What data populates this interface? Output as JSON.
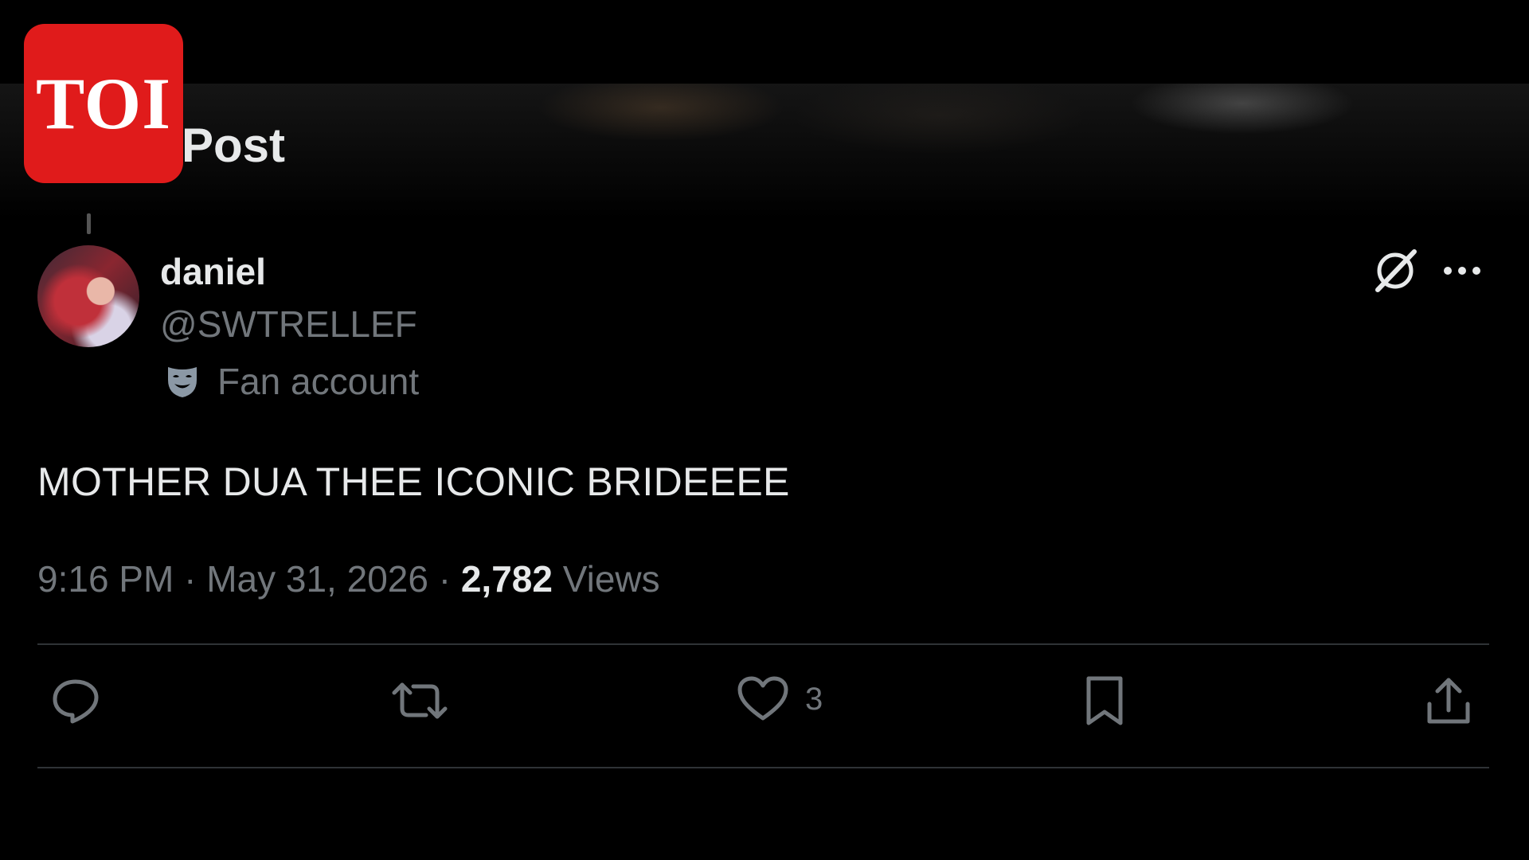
{
  "logo": {
    "text": "TOI",
    "color": "#e01b1b"
  },
  "header": {
    "title": "Post"
  },
  "author": {
    "display_name": "daniel",
    "handle": "@SWTRELLEF",
    "label_icon": "theater-mask-icon",
    "label": "Fan account"
  },
  "tweet": {
    "text": "MOTHER DUA THEE ICONIC BRIDEEEE",
    "time": "9:16 PM",
    "sep1": "·",
    "date": "May 31, 2026",
    "sep2": "·",
    "views_count": "2,782",
    "views_label": "Views"
  },
  "actions": {
    "reply": {
      "icon": "reply-icon"
    },
    "repost": {
      "icon": "repost-icon"
    },
    "like": {
      "icon": "heart-icon",
      "count": "3"
    },
    "bookmark": {
      "icon": "bookmark-icon"
    },
    "share": {
      "icon": "share-icon"
    }
  },
  "top_right": {
    "grok_icon": "grok-icon",
    "more_icon": "more-icon"
  },
  "colors": {
    "background": "#000000",
    "text": "#e7e9ea",
    "muted": "#71767b",
    "divider": "#2f3336"
  }
}
